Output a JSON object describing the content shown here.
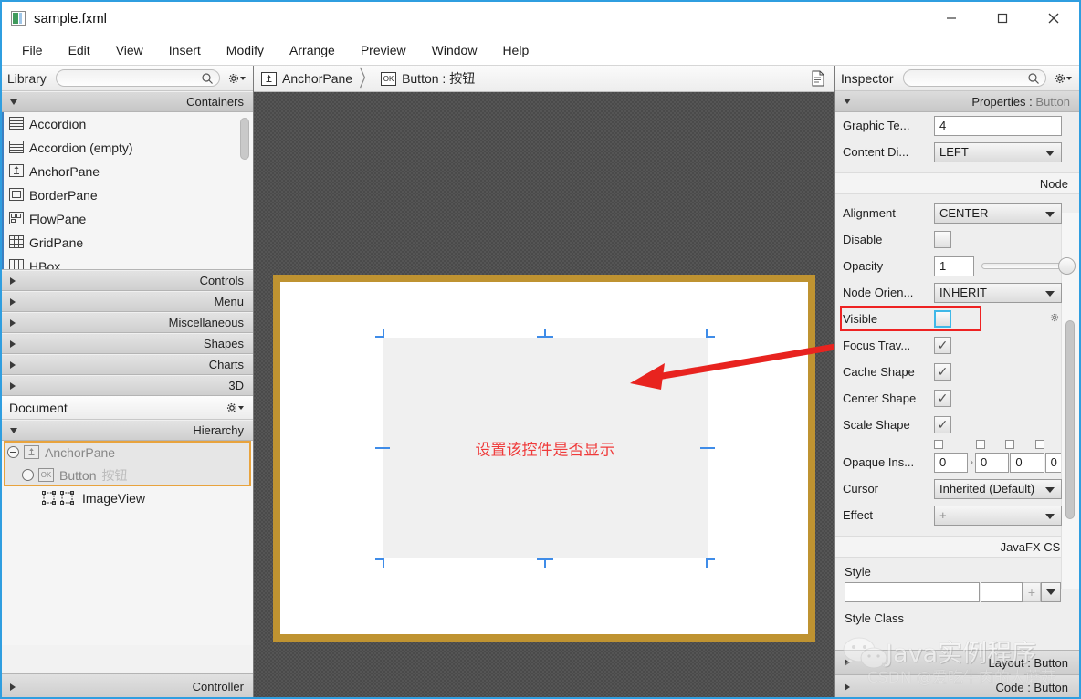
{
  "window": {
    "title": "sample.fxml",
    "icon": "fxml-file-icon",
    "controls": {
      "minimize": "minimize-icon",
      "maximize": "maximize-icon",
      "close": "close-icon"
    }
  },
  "menubar": {
    "items": [
      "File",
      "Edit",
      "View",
      "Insert",
      "Modify",
      "Arrange",
      "Preview",
      "Window",
      "Help"
    ]
  },
  "library": {
    "title": "Library",
    "search_value": "",
    "search_placeholder": "",
    "gear_label": "library-settings",
    "sections": [
      {
        "label": "Containers",
        "expanded": true
      },
      {
        "label": "Controls",
        "expanded": false
      },
      {
        "label": "Menu",
        "expanded": false
      },
      {
        "label": "Miscellaneous",
        "expanded": false
      },
      {
        "label": "Shapes",
        "expanded": false
      },
      {
        "label": "Charts",
        "expanded": false
      },
      {
        "label": "3D",
        "expanded": false
      }
    ],
    "container_items": [
      {
        "label": "Accordion",
        "icon": "accordion-icon"
      },
      {
        "label": "Accordion  (empty)",
        "icon": "accordion-icon"
      },
      {
        "label": "AnchorPane",
        "icon": "anchorpane-icon"
      },
      {
        "label": "BorderPane",
        "icon": "borderpane-icon"
      },
      {
        "label": "FlowPane",
        "icon": "flowpane-icon"
      },
      {
        "label": "GridPane",
        "icon": "gridpane-icon"
      },
      {
        "label": "HBox",
        "icon": "hbox-icon"
      }
    ]
  },
  "document": {
    "title": "Document",
    "hierarchy_label": "Hierarchy",
    "controller_label": "Controller",
    "tree": [
      {
        "label": "AnchorPane",
        "suffix": "",
        "icon": "anchorpane-icon",
        "depth": 0,
        "selected": true
      },
      {
        "label": "Button",
        "suffix": "按钮",
        "icon": "button-ok-icon",
        "depth": 1,
        "selected": true
      },
      {
        "label": "ImageView",
        "suffix": "",
        "icon": "imageview-icon",
        "depth": 2,
        "selected": false
      }
    ]
  },
  "breadcrumb": {
    "items": [
      {
        "label": "AnchorPane",
        "icon": "anchorpane-icon"
      },
      {
        "label": "Button : 按钮",
        "icon": "button-ok-icon"
      }
    ],
    "separator": "〉",
    "doc_icon": "document-icon"
  },
  "canvas": {
    "annotation_text": "设置该控件是否显示",
    "annotation_color": "#ef3b3b",
    "pane_border_color": "#bf9331",
    "pane_fill": "#ffffff",
    "button_fill": "#f0f0f0",
    "handle_color": "#3f8ce8",
    "arrow_color": "#e8231f"
  },
  "inspector": {
    "title": "Inspector",
    "search_value": "",
    "gear_label": "inspector-settings",
    "properties_header": "Properties",
    "properties_target": "Button",
    "group_node": "Node",
    "group_css": "JavaFX CSS",
    "rows": [
      {
        "label": "Graphic Te...",
        "type": "text",
        "value": "4"
      },
      {
        "label": "Content Di...",
        "type": "combo",
        "value": "LEFT"
      },
      {
        "label": "Alignment",
        "type": "combo",
        "value": "CENTER"
      },
      {
        "label": "Disable",
        "type": "checkbox",
        "checked": false
      },
      {
        "label": "Opacity",
        "type": "slider",
        "value": "1"
      },
      {
        "label": "Node Orien...",
        "type": "combo",
        "value": "INHERIT"
      },
      {
        "label": "Visible",
        "type": "checkbox",
        "checked": false,
        "highlighted": true
      },
      {
        "label": "Focus Trav...",
        "type": "checkbox",
        "checked": true
      },
      {
        "label": "Cache Shape",
        "type": "checkbox",
        "checked": true
      },
      {
        "label": "Center Shape",
        "type": "checkbox",
        "checked": true
      },
      {
        "label": "Scale Shape",
        "type": "checkbox",
        "checked": true
      },
      {
        "label": "Opaque Ins...",
        "type": "insets",
        "values": [
          "0",
          "0",
          "0",
          "0"
        ]
      },
      {
        "label": "Cursor",
        "type": "combo",
        "value": "Inherited (Default)"
      },
      {
        "label": "Effect",
        "type": "combo",
        "value": "+"
      }
    ],
    "style": {
      "label": "Style",
      "value": "",
      "value2": "",
      "add_label": "+"
    },
    "style_class_label": "Style Class",
    "bottom_sections": [
      {
        "label": "Layout : Button"
      },
      {
        "label": "Code : Button"
      }
    ]
  },
  "watermark": {
    "main": "Java实例程序",
    "sub": "CSDN @爱吃牛肉的大蘑菇",
    "logo": "wechat-icon"
  }
}
